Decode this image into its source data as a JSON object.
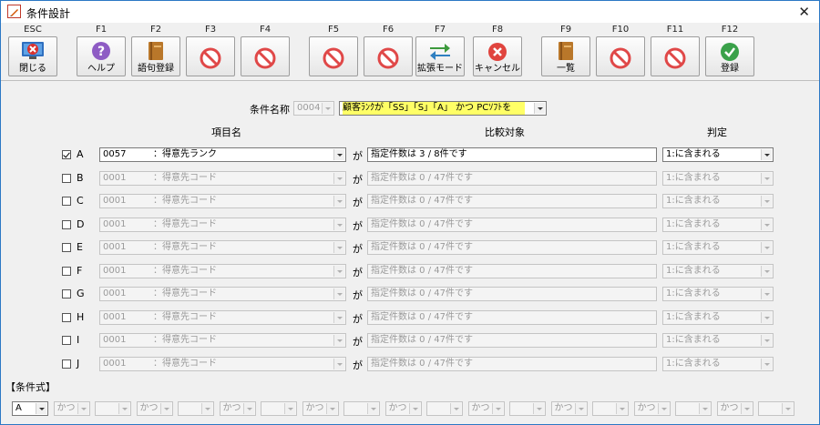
{
  "window": {
    "title": "条件設計",
    "close_glyph": "✕"
  },
  "toolbar": {
    "buttons": [
      {
        "key": "ESC",
        "label": "閉じる",
        "icon": "close-monitor-icon"
      },
      {
        "key": "F1",
        "label": "ヘルプ",
        "icon": "help-icon"
      },
      {
        "key": "F2",
        "label": "語句登録",
        "icon": "book-icon"
      },
      {
        "key": "F3",
        "label": "",
        "icon": "prohibited-icon"
      },
      {
        "key": "F4",
        "label": "",
        "icon": "prohibited-icon"
      },
      {
        "key": "F5",
        "label": "",
        "icon": "prohibited-icon"
      },
      {
        "key": "F6",
        "label": "",
        "icon": "prohibited-icon"
      },
      {
        "key": "F7",
        "label": "拡張モード",
        "icon": "swap-arrows-icon"
      },
      {
        "key": "F8",
        "label": "キャンセル",
        "icon": "cancel-icon"
      },
      {
        "key": "F9",
        "label": "一覧",
        "icon": "book-icon"
      },
      {
        "key": "F10",
        "label": "",
        "icon": "prohibited-icon"
      },
      {
        "key": "F11",
        "label": "",
        "icon": "prohibited-icon"
      },
      {
        "key": "F12",
        "label": "登録",
        "icon": "check-icon"
      }
    ]
  },
  "condition_name": {
    "label": "条件名称",
    "number": "0004",
    "value": "顧客ﾗﾝｸが「SS」「S」「A」 かつ PCｿﾌﾄを"
  },
  "headers": {
    "item": "項目名",
    "compare": "比較対象",
    "judge": "判定"
  },
  "connector": "が",
  "rows": [
    {
      "letter": "A",
      "checked": true,
      "code": "0057",
      "item": "：得意先ランク",
      "compare": "指定件数は 3 / 8件です",
      "judge": "1:に含まれる",
      "enabled": true
    },
    {
      "letter": "B",
      "checked": false,
      "code": "0001",
      "item": "：得意先コード",
      "compare": "指定件数は 0 / 47件です",
      "judge": "1:に含まれる",
      "enabled": false
    },
    {
      "letter": "C",
      "checked": false,
      "code": "0001",
      "item": "：得意先コード",
      "compare": "指定件数は 0 / 47件です",
      "judge": "1:に含まれる",
      "enabled": false
    },
    {
      "letter": "D",
      "checked": false,
      "code": "0001",
      "item": "：得意先コード",
      "compare": "指定件数は 0 / 47件です",
      "judge": "1:に含まれる",
      "enabled": false
    },
    {
      "letter": "E",
      "checked": false,
      "code": "0001",
      "item": "：得意先コード",
      "compare": "指定件数は 0 / 47件です",
      "judge": "1:に含まれる",
      "enabled": false
    },
    {
      "letter": "F",
      "checked": false,
      "code": "0001",
      "item": "：得意先コード",
      "compare": "指定件数は 0 / 47件です",
      "judge": "1:に含まれる",
      "enabled": false
    },
    {
      "letter": "G",
      "checked": false,
      "code": "0001",
      "item": "：得意先コード",
      "compare": "指定件数は 0 / 47件です",
      "judge": "1:に含まれる",
      "enabled": false
    },
    {
      "letter": "H",
      "checked": false,
      "code": "0001",
      "item": "：得意先コード",
      "compare": "指定件数は 0 / 47件です",
      "judge": "1:に含まれる",
      "enabled": false
    },
    {
      "letter": "I",
      "checked": false,
      "code": "0001",
      "item": "：得意先コード",
      "compare": "指定件数は 0 / 47件です",
      "judge": "1:に含まれる",
      "enabled": false
    },
    {
      "letter": "J",
      "checked": false,
      "code": "0001",
      "item": "：得意先コード",
      "compare": "指定件数は 0 / 47件です",
      "judge": "1:に含まれる",
      "enabled": false
    }
  ],
  "expression": {
    "label": "【条件式】",
    "items": [
      "A",
      "かつ",
      "",
      "かつ",
      "",
      "かつ",
      "",
      "かつ",
      "",
      "かつ",
      "",
      "かつ",
      "",
      "かつ",
      "",
      "かつ",
      "",
      "かつ",
      ""
    ]
  }
}
